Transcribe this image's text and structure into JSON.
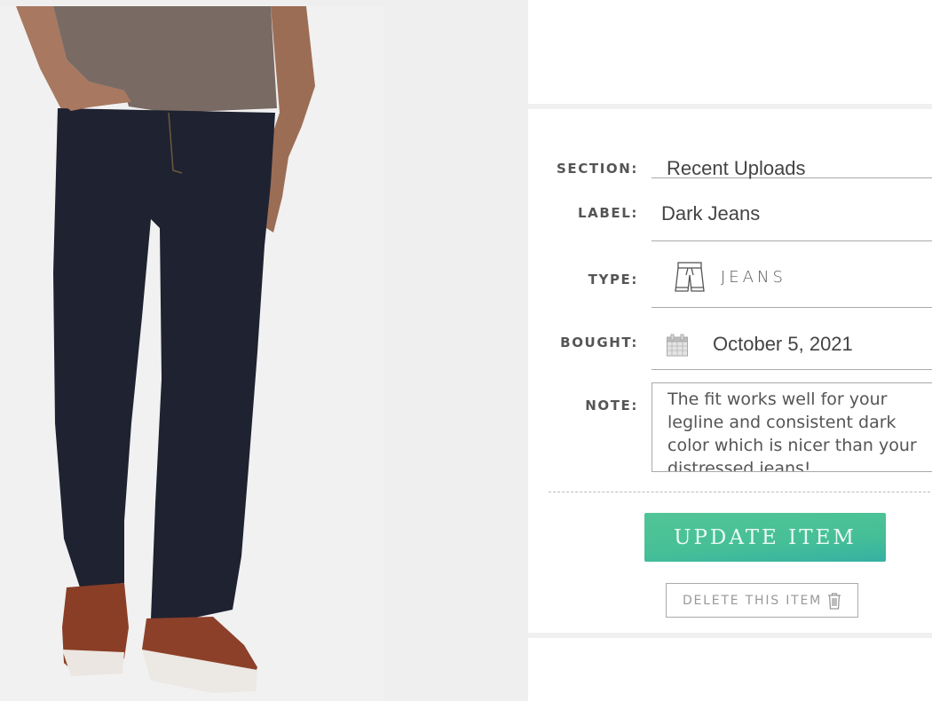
{
  "item": {
    "photo_alt": "Man wearing dark jeans, brown tee and brown leather sneakers"
  },
  "form": {
    "section": {
      "label": "SECTION:",
      "value": "Recent Uploads"
    },
    "label": {
      "label": "LABEL:",
      "value": "Dark Jeans"
    },
    "type": {
      "label": "TYPE:",
      "value": "JEANS",
      "icon": "pants-icon"
    },
    "bought": {
      "label": "BOUGHT:",
      "value": "October 5, 2021",
      "icon": "calendar-icon"
    },
    "note": {
      "label": "NOTE:",
      "value": "The fit works well for your legline and consistent dark color which is nicer than your distressed jeans!"
    }
  },
  "actions": {
    "update_label": "UPDATE ITEM",
    "delete_label": "DELETE THIS ITEM",
    "delete_icon": "trash-icon"
  },
  "colors": {
    "accent": "#46bf97",
    "accent_end": "#36b1a3",
    "label_text": "#555555",
    "border": "#aaaaaa"
  }
}
